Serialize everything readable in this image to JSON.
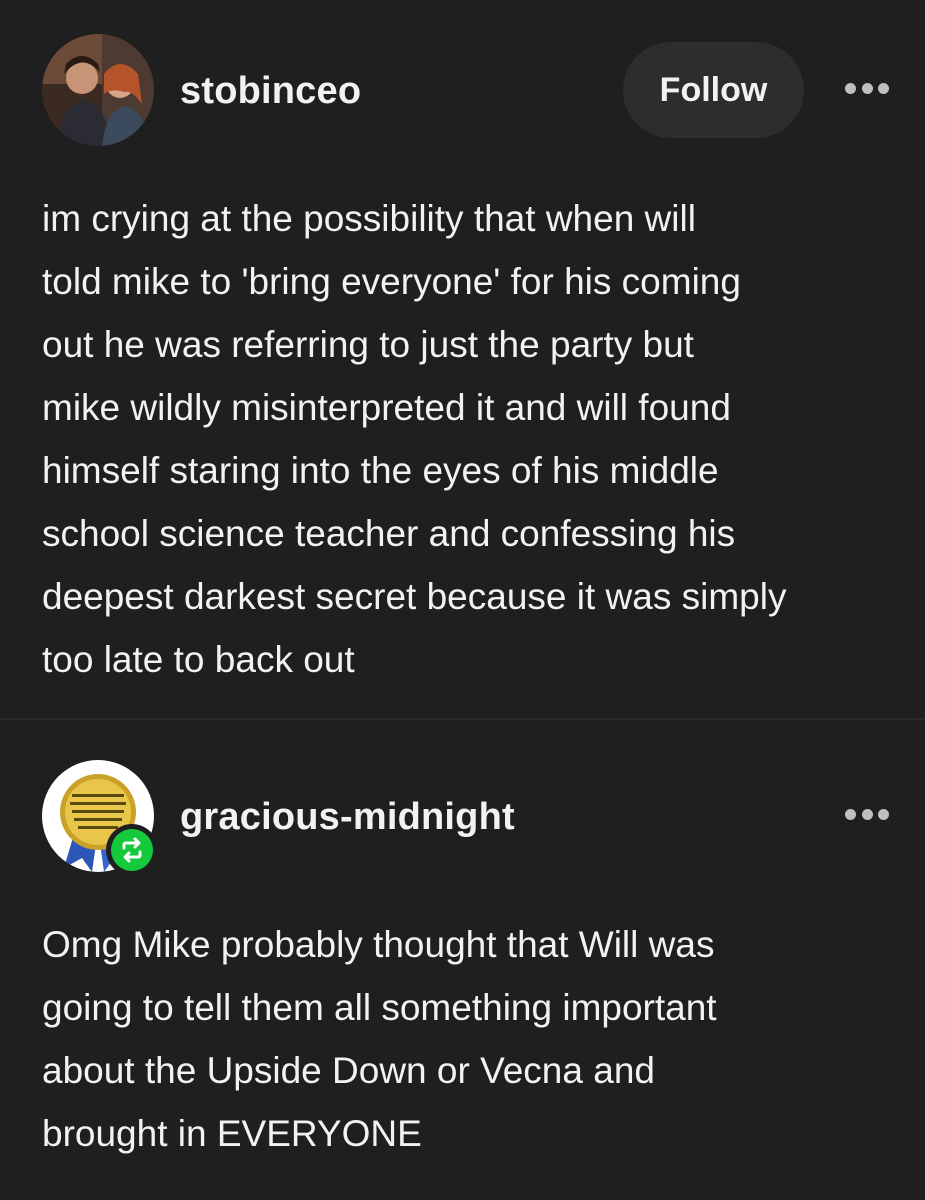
{
  "post1": {
    "username": "stobinceo",
    "follow_label": "Follow",
    "more_icon": "ellipsis-icon",
    "lines": [
      "im crying at the possibility that when will",
      "told mike to 'bring everyone' for his coming",
      "out he was referring to just the party but",
      "mike wildly misinterpreted it and will found",
      "himself staring into the eyes of his middle",
      "school science teacher and confessing his",
      "deepest darkest secret because it was simply",
      "too late to back out"
    ]
  },
  "post2": {
    "username": "gracious-midnight",
    "more_icon": "ellipsis-icon",
    "badge_icon": "reblog-icon",
    "lines": [
      "Omg Mike probably thought that Will was",
      "going to tell them all something important",
      "about the Upside Down or Vecna and",
      "brought in EVERYONE"
    ]
  },
  "colors": {
    "background": "#1f1f1f",
    "text": "#f2f2f2",
    "button_bg": "#2d2d2d",
    "reblog_green": "#14c93c"
  }
}
